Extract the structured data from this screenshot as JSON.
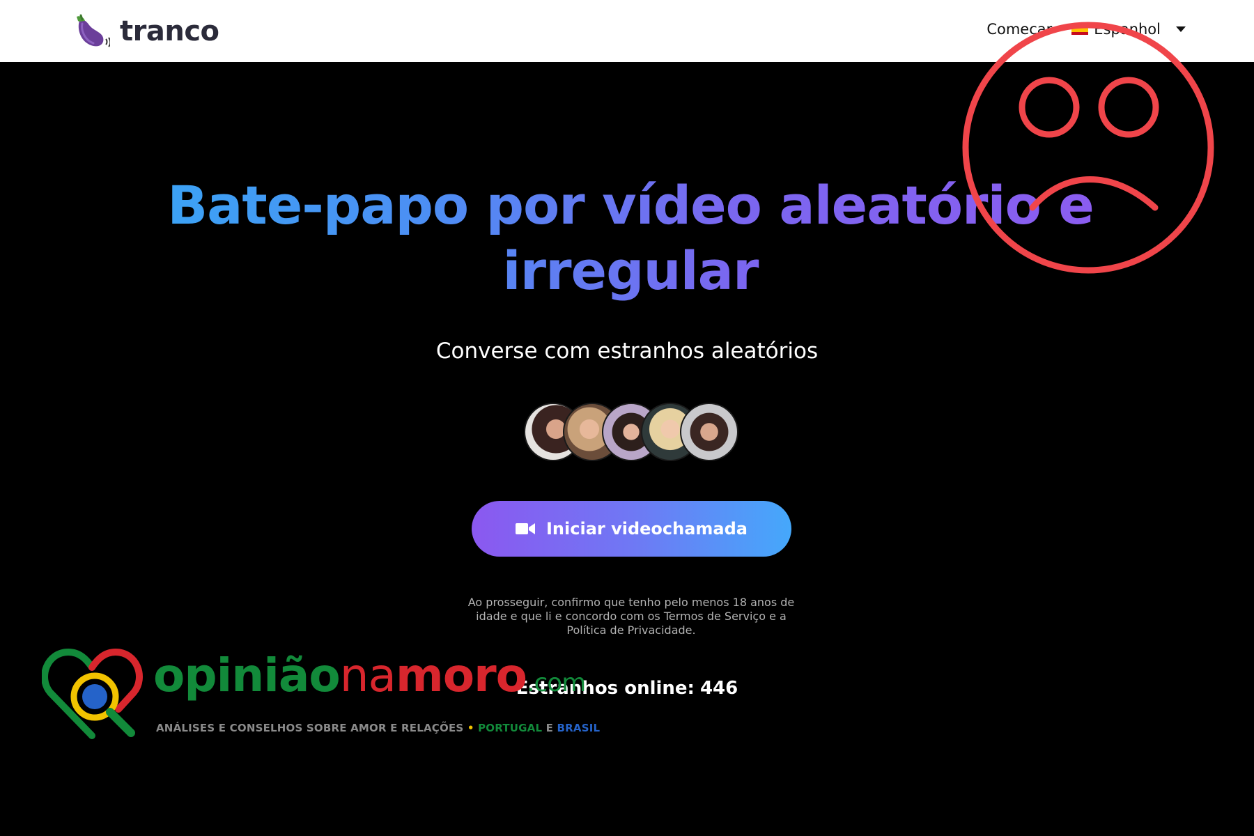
{
  "header": {
    "brand_name": "tranco",
    "nav_link": "Começar",
    "language": "Espanhol"
  },
  "hero": {
    "title_line1": "Bate-papo por vídeo aleatório e",
    "title_line2": "irregular",
    "subtitle": "Converse com estranhos aleatórios",
    "avatar_count": 5,
    "cta_label": "Iniciar videochamada",
    "legal_text": "Ao prosseguir, confirmo que tenho pelo menos 18 anos de idade e que li e concordo com os Termos de Serviço e a Política de Privacidade.",
    "online_label": "Estranhos online:",
    "online_count": "446"
  },
  "watermark": {
    "part1": "opinião",
    "part2": "na",
    "part3": "moro",
    "suffix": ".com",
    "tagline": "ANÁLISES E CONSELHOS SOBRE AMOR E RELAÇÕES",
    "tag_dot": "•",
    "tag_pt": "PORTUGAL",
    "tag_e": "E",
    "tag_br": "BRASIL"
  },
  "colors": {
    "title_gradient_start": "#3aa4f5",
    "title_gradient_end": "#8c5cf0",
    "cta_gradient_start": "#8b58f0",
    "cta_gradient_end": "#45a8fb",
    "sad_face": "#f0454a",
    "watermark_green": "#128a3a",
    "watermark_red": "#d8262d"
  },
  "icons": {
    "brand": "eggplant-icon",
    "flag": "spain-flag-icon",
    "dropdown": "caret-down-icon",
    "cta": "video-camera-icon",
    "overlay": "sad-face-icon"
  }
}
